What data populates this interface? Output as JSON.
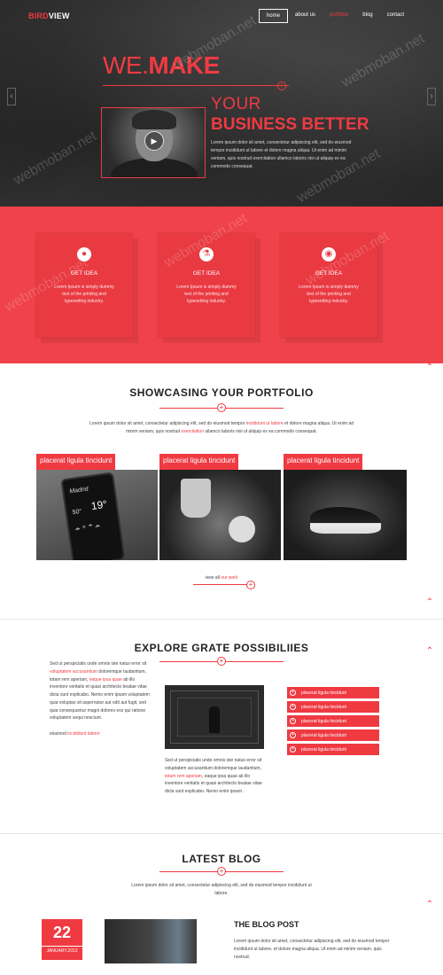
{
  "brand": {
    "part1": "BIRD",
    "part2": "VIEW"
  },
  "nav": [
    "home",
    "about us",
    "portfolio",
    "blog",
    "contact"
  ],
  "hero": {
    "headline_light": "WE.",
    "headline_bold": "MAKE",
    "sub1": "YOUR",
    "sub2": "BUSINESS BETTER",
    "text": "Lorem ipsum dolor sit amet, consectetur adipiscing elit, sed do eiusmod tempor incididunt ut labore et dolore magna aliqua. Ut enim ad minim veniam, quis nostrud exercitation ullamco laboris nisi ut aliquip ex ea commodo consequat.",
    "prev_arrow": "‹",
    "next_arrow": "›",
    "play_icon": "▶"
  },
  "features": [
    {
      "icon": "github-icon",
      "title": "GET IDEA",
      "text": "Lorem Ipsum is simply dummy text of the printing and typesetting industry."
    },
    {
      "icon": "flask-icon",
      "title": "GET IDEA",
      "text": "Lorem Ipsum is simply dummy text of the printing and typesetting industry."
    },
    {
      "icon": "globe-icon",
      "title": "GET IDEA",
      "text": "Lorem Ipsum is simply dummy text of the printing and typesetting industry."
    }
  ],
  "portfolio": {
    "title": "SHOWCASING YOUR PORTFOLIO",
    "intro_a": "Lorem ipsum dolor sit amet, consectetur adipiscing elit, sed do eiusmod tempor ",
    "intro_red1": "incididunt ut labore",
    "intro_b": " et dolore magna aliqua. Ut enim ad",
    "intro_c": "minim veniam, quis nostrud ",
    "intro_red2": "exercitation",
    "intro_d": " ullamco laboris nisi ut aliquip ex ea commodo consequat.",
    "items": [
      {
        "label": "placerat ligula tincidunt",
        "phone_city": "Madrid",
        "phone_temp": "19°",
        "phone_temp2": "50°"
      },
      {
        "label": "placerat ligula tincidunt"
      },
      {
        "label": "placerat ligula tincidunt"
      }
    ],
    "viewall_a": "view all ",
    "viewall_red": "our work"
  },
  "explore": {
    "title": "EXPLORE GRATE POSSIBILIIES",
    "left_a": "Sed ut perspiciatis unde omnis iste natus error sit ",
    "left_red1": "voluptatem accusantium",
    "left_b": " doloremque laudantium, totam rem aperiam, ",
    "left_red2": "eaque ipsa quae",
    "left_c": " ab illo inventore veritatis et quasi architecto beatae vitae dicta sunt explicabo. Nemo enim ipsam voluptatem quia voluptas sit aspernatur aut odit aut fugit, sed quia consequuntur magni dolores eos qui ratione voluptatem sequi nesciunt.",
    "left_d": "eiusmod ",
    "left_red3": "incididunt labore",
    "mid_a": "Sed ut perspiciatis unde omnis iste natus error sit voluptatem accusantium doloremque laudantium, ",
    "mid_red": "totam rem aperiam",
    "mid_b": ", eaque ipsa quae ab illo inventore veritatis et quasi architecto beatae vitae dicta sunt explicabo. Nemo enim ipsam .",
    "list": [
      "placerat ligula tincidunt",
      "placerat ligula tincidunt",
      "placerat ligula tincidunt",
      "placerat ligula tincidunt",
      "placerat ligula tincidunt"
    ]
  },
  "blog": {
    "title": "LATEST BLOG",
    "intro": "Lorem ipsum dolor sit amet, consectetur adipiscing elit, sed do eiusmod tempor incididunt ut labore.",
    "day": "22",
    "month": "JANUARY,2013",
    "post_title": "THE BLOG POST",
    "post_text": "Lorem ipsum dolor sit amet, consectetur adipiscing elit, sed do eiusmod tempor incididunt ut labore. et dolore magna aliqua. Ut enim ad minim veniam, quis nostrud."
  },
  "watermark": "webmoban.net",
  "colors": {
    "accent": "#ef3a42",
    "dark": "#2b2b2b"
  }
}
